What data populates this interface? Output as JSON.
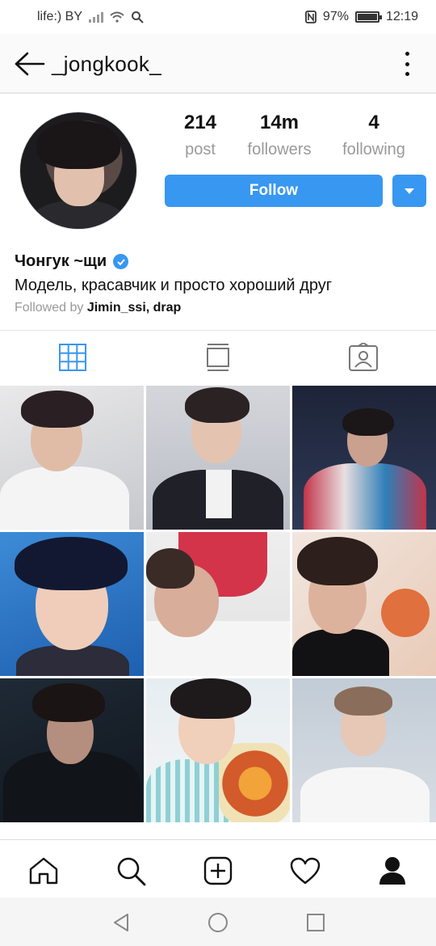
{
  "status": {
    "carrier": "life:) BY",
    "battery": "97%",
    "time": "12:19",
    "battery_level": 0.97
  },
  "header": {
    "username": "_jongkook_"
  },
  "profile": {
    "stats": [
      {
        "value": "214",
        "label": "post"
      },
      {
        "value": "14m",
        "label": "followers"
      },
      {
        "value": "4",
        "label": "following"
      }
    ],
    "follow_label": "Follow",
    "full_name": "Чонгук ~щи",
    "bio": "Модель, красавчик и просто хороший друг",
    "followed_by_prefix": "Followed by",
    "followed_by_names": "Jimin_ssi, drap"
  },
  "tabs": [
    "grid-icon",
    "feed-icon",
    "tagged-icon"
  ],
  "grid_posts": [
    {
      "icon": "photo-1"
    },
    {
      "icon": "photo-2"
    },
    {
      "icon": "photo-3"
    },
    {
      "icon": "photo-4"
    },
    {
      "icon": "photo-5"
    },
    {
      "icon": "photo-6"
    },
    {
      "icon": "photo-7"
    },
    {
      "icon": "photo-8"
    },
    {
      "icon": "photo-9"
    }
  ],
  "bottom_nav": [
    "home-icon",
    "search-icon",
    "add-post-icon",
    "activity-heart-icon",
    "profile-icon"
  ],
  "system_nav": [
    "back-icon",
    "home-icon",
    "recents-icon"
  ],
  "colors": {
    "accent": "#3897f0",
    "muted": "#9a9a9a"
  }
}
